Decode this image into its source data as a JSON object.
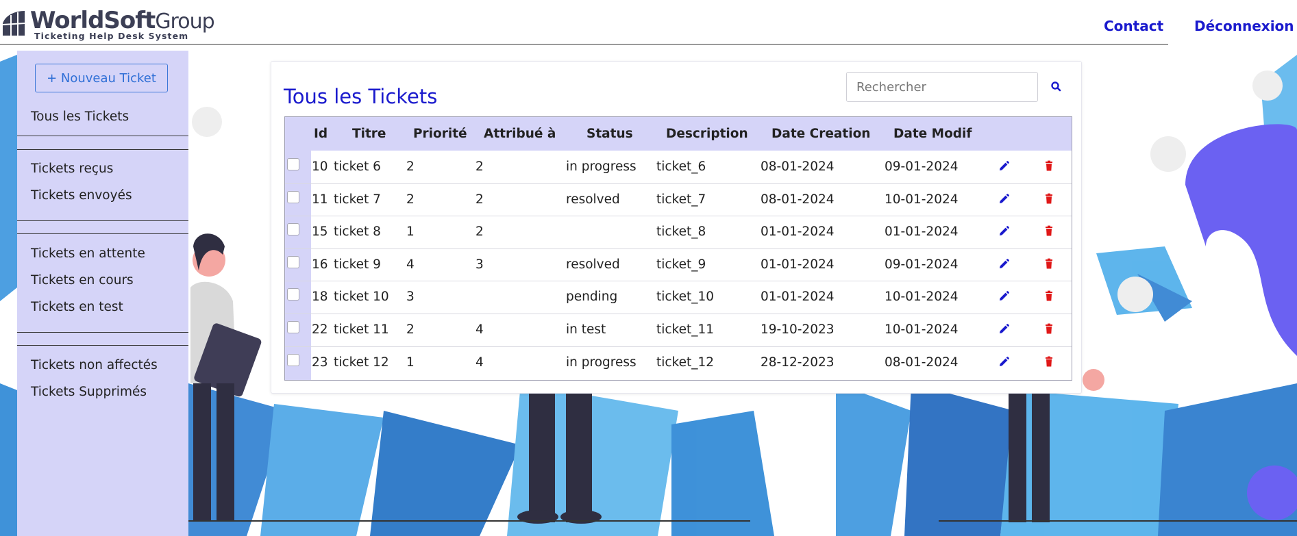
{
  "brand": {
    "name_bold": "World",
    "name_mid": "Soft",
    "name_light": "Group",
    "tagline": "Ticketing Help Desk System"
  },
  "nav": {
    "contact": "Contact",
    "logout": "Déconnexion"
  },
  "sidebar": {
    "new_ticket": "+ Nouveau Ticket",
    "items": {
      "all": "Tous les Tickets",
      "received": "Tickets reçus",
      "sent": "Tickets envoyés",
      "waiting": "Tickets en attente",
      "in_progress": "Tickets en cours",
      "in_test": "Tickets en test",
      "unassigned": "Tickets non affectés",
      "deleted": "Tickets Supprimés"
    }
  },
  "main": {
    "title": "Tous les Tickets",
    "search": {
      "placeholder": "Rechercher",
      "value": "",
      "icon": "search-icon"
    },
    "table": {
      "headers": {
        "id": "Id",
        "titre": "Titre",
        "priorite": "Priorité",
        "attribue": "Attribué à",
        "status": "Status",
        "description": "Description",
        "date_creation": "Date Creation",
        "date_modif": "Date Modif"
      },
      "rows": [
        {
          "id": "10",
          "titre": "ticket 6",
          "priorite": "2",
          "attribue": "2",
          "status": "in progress",
          "description": "ticket_6",
          "date_creation": "08-01-2024",
          "date_modif": "09-01-2024"
        },
        {
          "id": "11",
          "titre": "ticket 7",
          "priorite": "2",
          "attribue": "2",
          "status": "resolved",
          "description": "ticket_7",
          "date_creation": "08-01-2024",
          "date_modif": "10-01-2024"
        },
        {
          "id": "15",
          "titre": "ticket 8",
          "priorite": "1",
          "attribue": "2",
          "status": "",
          "description": "ticket_8",
          "date_creation": "01-01-2024",
          "date_modif": "01-01-2024"
        },
        {
          "id": "16",
          "titre": "ticket 9",
          "priorite": "4",
          "attribue": "3",
          "status": "resolved",
          "description": "ticket_9",
          "date_creation": "01-01-2024",
          "date_modif": "09-01-2024"
        },
        {
          "id": "18",
          "titre": "ticket 10",
          "priorite": "3",
          "attribue": "",
          "status": "pending",
          "description": "ticket_10",
          "date_creation": "01-01-2024",
          "date_modif": "10-01-2024"
        },
        {
          "id": "22",
          "titre": "ticket 11",
          "priorite": "2",
          "attribue": "4",
          "status": "in test",
          "description": "ticket_11",
          "date_creation": "19-10-2023",
          "date_modif": "10-01-2024"
        },
        {
          "id": "23",
          "titre": "ticket 12",
          "priorite": "1",
          "attribue": "4",
          "status": "in progress",
          "description": "ticket_12",
          "date_creation": "28-12-2023",
          "date_modif": "08-01-2024"
        }
      ],
      "row_icons": {
        "edit": "pencil-icon",
        "delete": "trash-icon"
      }
    }
  },
  "colors": {
    "accent": "#1a1acd",
    "sidebar_bg": "#d5d4f8",
    "delete": "#e01818",
    "button_border": "#3d78d8"
  }
}
